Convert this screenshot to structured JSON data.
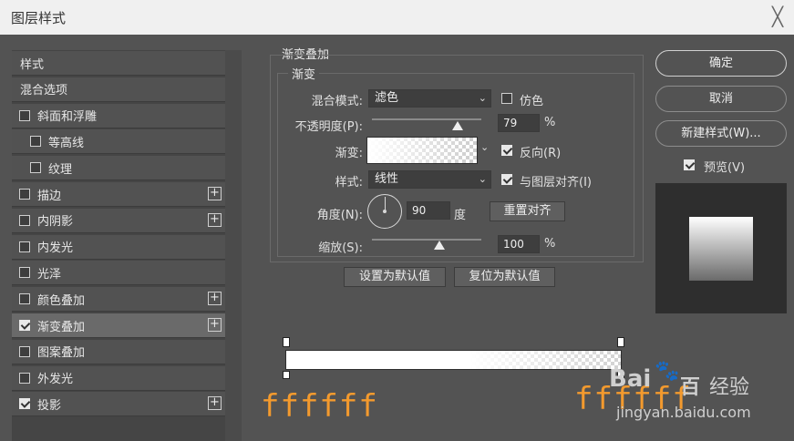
{
  "window": {
    "title": "图层样式",
    "close_glyph": "╳"
  },
  "sidebar": {
    "items": [
      {
        "label": "样式",
        "checkbox": false
      },
      {
        "label": "混合选项",
        "checkbox": false
      },
      {
        "label": "斜面和浮雕",
        "checkbox": true,
        "checked": false
      },
      {
        "label": "等高线",
        "checkbox": true,
        "checked": false,
        "indent": true
      },
      {
        "label": "纹理",
        "checkbox": true,
        "checked": false,
        "indent": true
      },
      {
        "label": "描边",
        "checkbox": true,
        "checked": false,
        "plus": true
      },
      {
        "label": "内阴影",
        "checkbox": true,
        "checked": false,
        "plus": true
      },
      {
        "label": "内发光",
        "checkbox": true,
        "checked": false
      },
      {
        "label": "光泽",
        "checkbox": true,
        "checked": false
      },
      {
        "label": "颜色叠加",
        "checkbox": true,
        "checked": false,
        "plus": true
      },
      {
        "label": "渐变叠加",
        "checkbox": true,
        "checked": true,
        "plus": true,
        "selected": true
      },
      {
        "label": "图案叠加",
        "checkbox": true,
        "checked": false
      },
      {
        "label": "外发光",
        "checkbox": true,
        "checked": false
      },
      {
        "label": "投影",
        "checkbox": true,
        "checked": true,
        "plus": true
      }
    ]
  },
  "panel": {
    "section_title": "渐变叠加",
    "group_title": "渐变",
    "blend_mode_label": "混合模式:",
    "blend_mode_value": "滤色",
    "dither_label": "仿色",
    "opacity_label": "不透明度(P):",
    "opacity_value": "79",
    "opacity_unit": "%",
    "gradient_label": "渐变:",
    "reverse_label": "反向(R)",
    "style_label": "样式:",
    "style_value": "线性",
    "align_label": "与图层对齐(I)",
    "angle_label": "角度(N):",
    "angle_value": "90",
    "angle_unit": "度",
    "reset_align_label": "重置对齐",
    "scale_label": "缩放(S):",
    "scale_value": "100",
    "scale_unit": "%",
    "set_default_label": "设置为默认值",
    "reset_default_label": "复位为默认值"
  },
  "gradient_editor": {
    "left_color_note": "ffffff",
    "right_color_note": "ffffff"
  },
  "actions": {
    "ok": "确定",
    "cancel": "取消",
    "new_style": "新建样式(W)...",
    "preview_label": "预览(V)"
  },
  "watermark": {
    "brand": "Bai",
    "brand2": "百",
    "brand3": "经验",
    "url": "jingyan.baidu.com"
  },
  "colors": {
    "bg": "#535353",
    "panel": "#454545",
    "accent": "#f39a2e"
  }
}
